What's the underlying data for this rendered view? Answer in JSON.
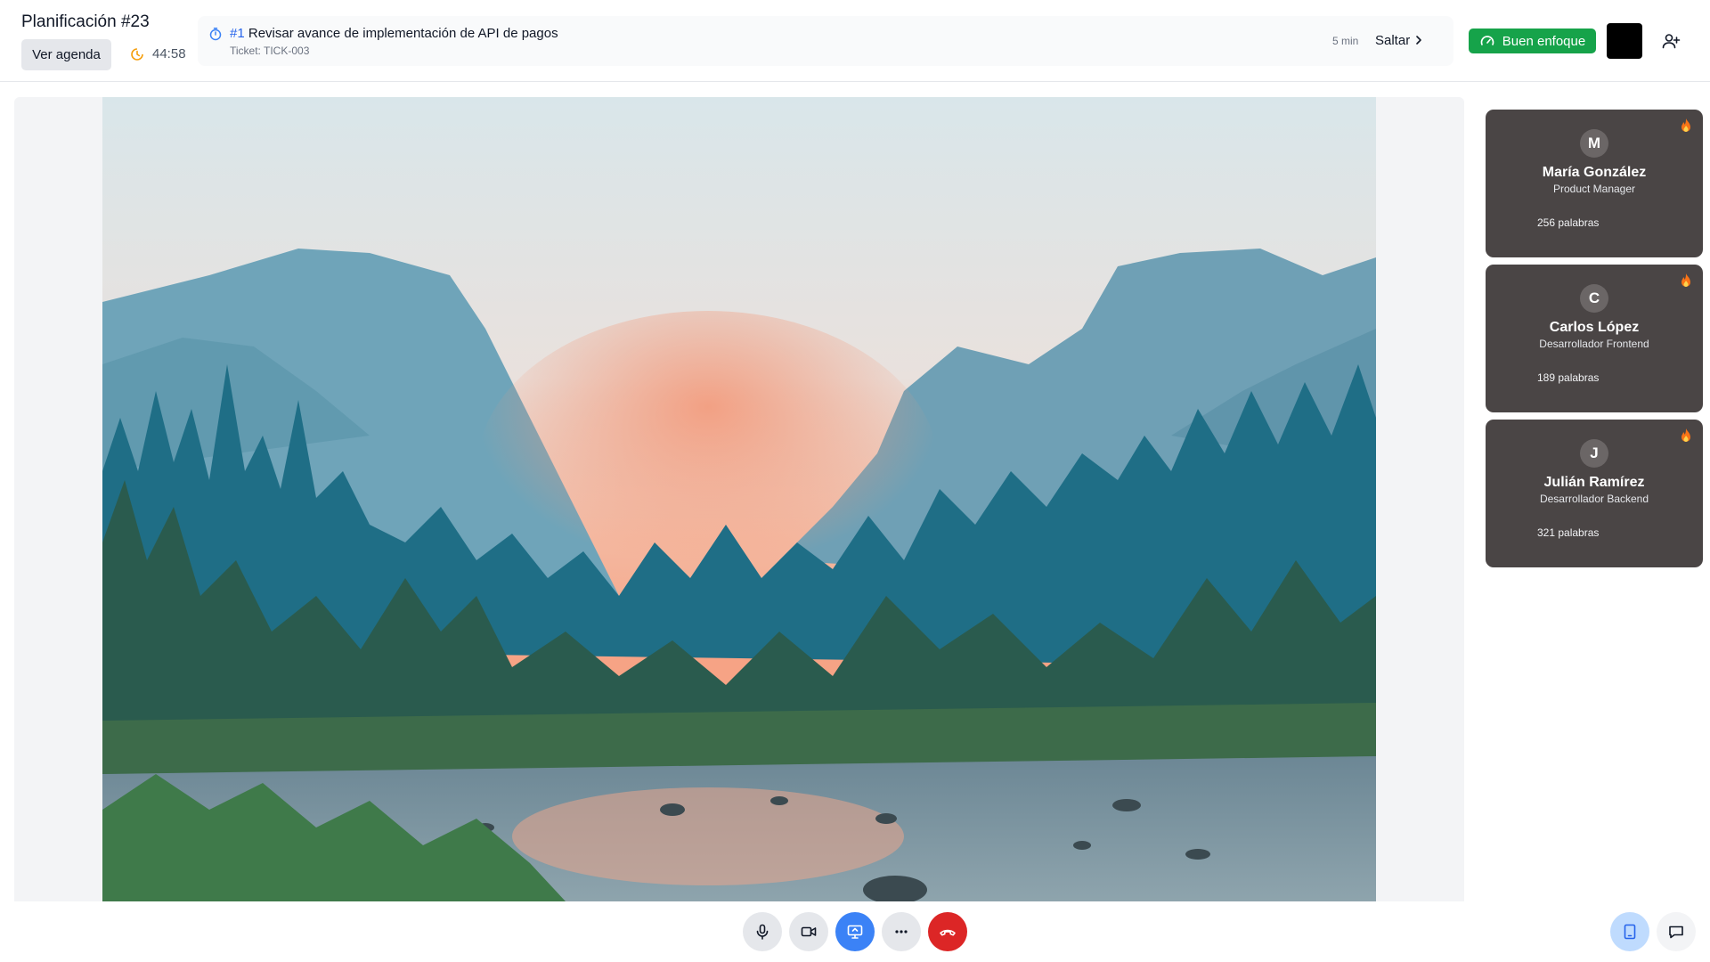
{
  "header": {
    "title": "Planificación #23",
    "agenda_button": "Ver agenda",
    "timer": "44:58",
    "current_item": {
      "number": "#1",
      "title": "Revisar avance de implementación de API de pagos",
      "ticket": "Ticket: TICK-003",
      "duration": "5 min"
    },
    "skip_label": "Saltar",
    "focus_badge": "Buen enfoque"
  },
  "participants": [
    {
      "initial": "M",
      "name": "María González",
      "role": "Product Manager",
      "words": "256 palabras"
    },
    {
      "initial": "C",
      "name": "Carlos López",
      "role": "Desarrollador Frontend",
      "words": "189 palabras"
    },
    {
      "initial": "J",
      "name": "Julián Ramírez",
      "role": "Desarrollador Backend",
      "words": "321 palabras"
    }
  ],
  "icons": {
    "timer": "clock-icon",
    "agenda_item": "stopwatch-icon",
    "skip": "chevron-right-icon",
    "focus": "gauge-icon",
    "add_user": "user-plus-icon",
    "engagement": "fire-icon",
    "controls": [
      "microphone-icon",
      "camera-icon",
      "screen-share-icon",
      "more-icon",
      "hang-up-icon"
    ],
    "right_controls": [
      "tablet-icon",
      "chat-icon"
    ]
  },
  "colors": {
    "accent_blue": "#3b82f6",
    "focus_green": "#16a34a",
    "end_call_red": "#dc2626",
    "card_bg": "#4a4545"
  }
}
